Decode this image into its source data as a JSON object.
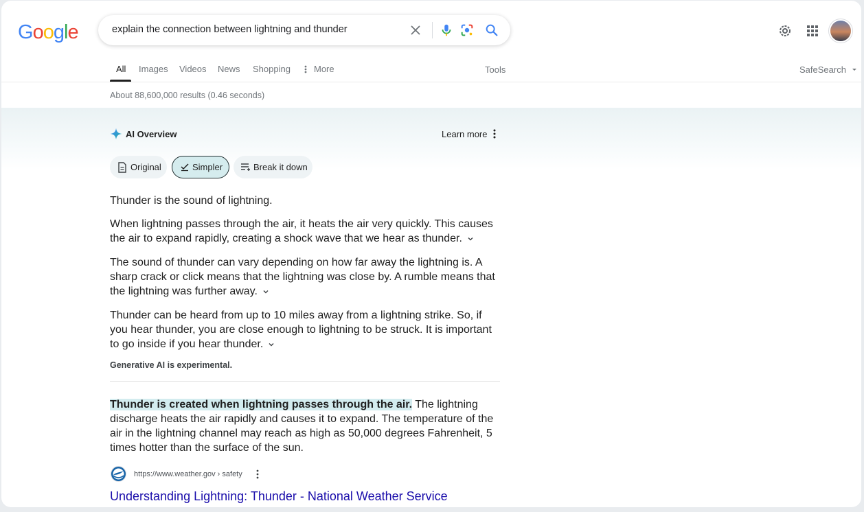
{
  "logo": {
    "letters": [
      "G",
      "o",
      "o",
      "g",
      "l",
      "e"
    ]
  },
  "colors": {
    "blue": "#4285F4",
    "red": "#EA4335",
    "yellow": "#FBBC05",
    "green": "#34A853",
    "link": "#1a0dab",
    "highlight": "#d3ecef"
  },
  "search": {
    "query": "explain the connection between lightning and thunder"
  },
  "icons": {
    "clear": "close-icon",
    "voice": "mic-icon",
    "lens": "lens-icon",
    "search": "search-icon",
    "settings": "gear-icon",
    "apps": "apps-icon",
    "more": "more-vert-icon",
    "sparkle": "sparkle-icon"
  },
  "tabs": [
    {
      "label": "All"
    },
    {
      "label": "Images"
    },
    {
      "label": "Videos"
    },
    {
      "label": "News"
    },
    {
      "label": "Shopping"
    },
    {
      "label": "More"
    }
  ],
  "tools_label": "Tools",
  "safesearch_label": "SafeSearch",
  "stats": "About 88,600,000 results (0.46 seconds)",
  "ai_overview": {
    "title": "AI Overview",
    "learn_more": "Learn more",
    "chips": [
      {
        "label": "Original",
        "selected": false
      },
      {
        "label": "Simpler",
        "selected": true
      },
      {
        "label": "Break it down",
        "selected": false
      }
    ],
    "paragraphs": [
      "Thunder is the sound of lightning.",
      "When lightning passes through the air, it heats the air very quickly. This causes the air to expand rapidly, creating a shock wave that we hear as thunder.",
      "The sound of thunder can vary depending on how far away the lightning is. A sharp crack or click means that the lightning was close by. A rumble means that the lightning was further away.",
      "Thunder can be heard from up to 10 miles away from a lightning strike. So, if you hear thunder, you are close enough to lightning to be struck. It is important to go inside if you hear thunder."
    ],
    "note": "Generative AI is experimental."
  },
  "featured": {
    "highlight": "Thunder is created when lightning passes through the air.",
    "rest": " The lightning discharge heats the air rapidly and causes it to expand. The temperature of the air in the lightning channel may reach as high as 50,000 degrees Fahrenheit, 5 times hotter than the surface of the sun.",
    "source_url": "https://www.weather.gov › safety",
    "title": "Understanding Lightning: Thunder - National Weather Service"
  }
}
